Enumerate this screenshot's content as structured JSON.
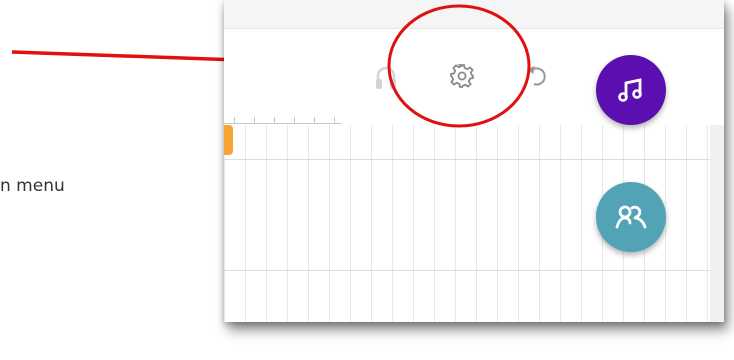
{
  "caption": {
    "text": "n menu"
  },
  "toolbar": {
    "icons": [
      "headphones-icon",
      "gear-icon",
      "undo-icon"
    ]
  },
  "fabs": [
    {
      "name": "music-button",
      "icon": "music-note-icon",
      "color": "#5b0fb0"
    },
    {
      "name": "collaborators-button",
      "icon": "people-icon",
      "color": "#52a3b6"
    }
  ],
  "colors": {
    "annotation_red": "#e01010",
    "playhead": "#f4a534",
    "icon_gray": "#8a8a8a"
  }
}
